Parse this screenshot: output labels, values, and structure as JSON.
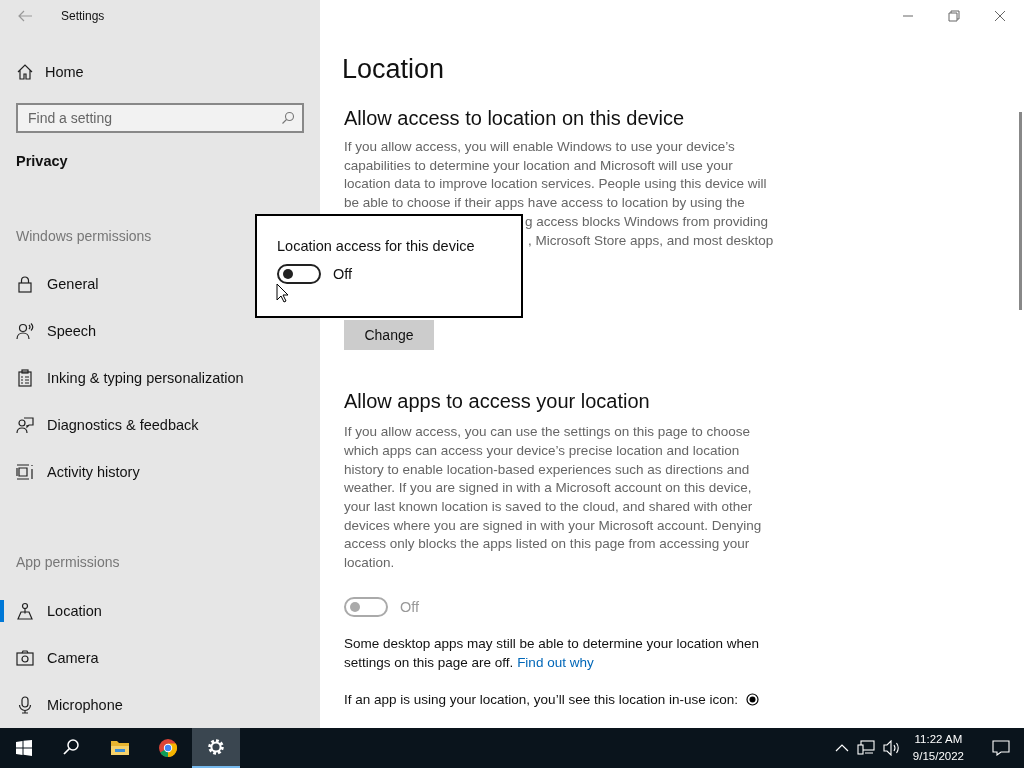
{
  "window": {
    "title": "Settings"
  },
  "sidebar": {
    "home": "Home",
    "search": {
      "placeholder": "Find a setting"
    },
    "section": "Privacy",
    "groups": [
      {
        "heading": "Windows permissions",
        "items": [
          {
            "label": "General",
            "kind": "lock",
            "selected": false
          },
          {
            "label": "Speech",
            "kind": "speech",
            "selected": false
          },
          {
            "label": "Inking & typing personalization",
            "kind": "clipboard",
            "selected": false
          },
          {
            "label": "Diagnostics & feedback",
            "kind": "feedback",
            "selected": false
          },
          {
            "label": "Activity history",
            "kind": "activity",
            "selected": false
          }
        ]
      },
      {
        "heading": "App permissions",
        "items": [
          {
            "label": "Location",
            "kind": "location",
            "selected": true
          },
          {
            "label": "Camera",
            "kind": "camera",
            "selected": false
          },
          {
            "label": "Microphone",
            "kind": "microphone",
            "selected": false
          }
        ]
      }
    ]
  },
  "main": {
    "title": "Location",
    "device_section": {
      "heading": "Allow access to location on this device",
      "description_lines": [
        "If you allow access, you will enable Windows to use your device’s",
        "capabilities to determine your location and Microsoft will use your",
        "location data to improve location services. People using this device will",
        "be able to choose if their apps have access to location by using the"
      ],
      "partly_covered_lines": [
        "g access blocks Windows from providing",
        ", Microsoft Store apps, and most desktop"
      ],
      "button": "Change"
    },
    "apps_section": {
      "heading": "Allow apps to access your location",
      "description": "If you allow access, you can use the settings on this page to choose which apps can access your device’s precise location and location history to enable location-based experiences such as directions and weather. If you are signed in with a Microsoft account on this device, your last known location is saved to the cloud, and shared with other devices where you are signed in with your Microsoft account. Denying access only blocks the apps listed on this page from accessing your location.",
      "toggle": {
        "on": false,
        "disabled": true,
        "label": "Off"
      }
    },
    "note": {
      "text": "Some desktop apps may still be able to determine your location when settings on this page are off.",
      "link": "Find out why"
    },
    "inuse_note": "If an app is using your location, you’ll see this location in-use icon:"
  },
  "popup": {
    "title": "Location access for this device",
    "toggle": {
      "on": false,
      "disabled": false,
      "label": "Off"
    }
  },
  "taskbar": {
    "apps": [
      {
        "kind": "search",
        "selected": false
      },
      {
        "kind": "files",
        "selected": false
      },
      {
        "kind": "browser",
        "selected": false
      },
      {
        "kind": "settings",
        "selected": true
      }
    ],
    "time": "11:22 AM",
    "date": "9/15/2022"
  }
}
